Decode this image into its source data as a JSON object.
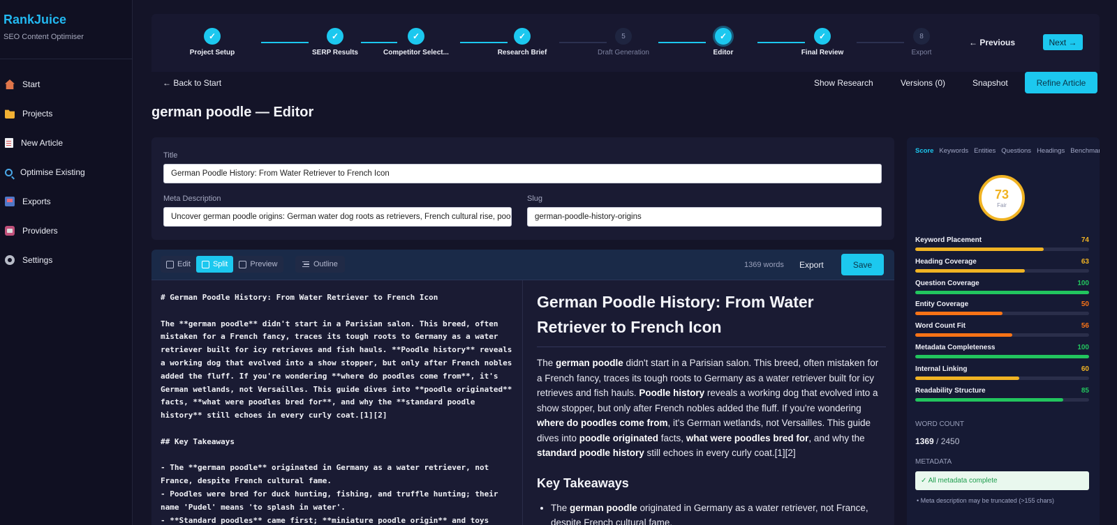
{
  "brand": {
    "name": "RankJuice",
    "subtitle": "SEO Content Optimiser"
  },
  "nav": [
    {
      "label": "Start",
      "icon": "home-icon"
    },
    {
      "label": "Projects",
      "icon": "folder-icon"
    },
    {
      "label": "New Article",
      "icon": "document-icon"
    },
    {
      "label": "Optimise Existing",
      "icon": "search-icon"
    },
    {
      "label": "Exports",
      "icon": "export-icon"
    },
    {
      "label": "Providers",
      "icon": "providers-icon"
    },
    {
      "label": "Settings",
      "icon": "gear-icon"
    }
  ],
  "stepper": {
    "steps": [
      {
        "label": "Project Setup",
        "state": "done",
        "mark": "✓"
      },
      {
        "label": "SERP Results",
        "state": "done",
        "mark": "✓"
      },
      {
        "label": "Competitor Select...",
        "state": "done",
        "mark": "✓"
      },
      {
        "label": "Research Brief",
        "state": "done",
        "mark": "✓"
      },
      {
        "label": "Draft Generation",
        "state": "pending",
        "mark": "5"
      },
      {
        "label": "Editor",
        "state": "active",
        "mark": "✓"
      },
      {
        "label": "Final Review",
        "state": "done",
        "mark": "✓"
      },
      {
        "label": "Export",
        "state": "pending",
        "mark": "8"
      }
    ],
    "previous_label": "← Previous",
    "next_label": "Next →"
  },
  "actions": {
    "back_label": "← Back to Start",
    "show_research": "Show Research",
    "versions": "Versions (0)",
    "snapshot": "Snapshot",
    "refine": "Refine Article"
  },
  "page_title": "german poodle — Editor",
  "fields": {
    "title_label": "Title",
    "title_value": "German Poodle History: From Water Retriever to French Icon",
    "meta_label": "Meta Description",
    "meta_value": "Uncover german poodle origins: German water dog roots as retrievers, French cultural rise, poodle history facts and more.",
    "slug_label": "Slug",
    "slug_value": "german-poodle-history-origins"
  },
  "editor": {
    "modes": [
      "Edit",
      "Split",
      "Preview"
    ],
    "selected_mode": "Split",
    "outline_label": "Outline",
    "word_count": "1369 words",
    "export_label": "Export",
    "save_label": "Save",
    "source": "# German Poodle History: From Water Retriever to French Icon\n\nThe **german poodle** didn't start in a Parisian salon. This breed, often mistaken for a French fancy, traces its tough roots to Germany as a water retriever built for icy retrieves and fish hauls. **Poodle history** reveals a working dog that evolved into a show stopper, but only after French nobles added the fluff. If you're wondering **where do poodles come from**, it's German wetlands, not Versailles. This guide dives into **poodle originated** facts, **what were poodles bred for**, and why the **standard poodle history** still echoes in every curly coat.[1][2]\n\n## Key Takeaways\n\n- The **german poodle** originated in Germany as a water retriever, not France, despite French cultural fame.\n- Poodles were bred for duck hunting, fishing, and truffle hunting; their name 'Pudel' means 'to splash in water'.\n- **Standard poodles** came first; **miniature poodle origin** and toys",
    "preview": {
      "h1": "German Poodle History: From Water Retriever to French Icon",
      "intro_html": "The <b>german poodle</b> didn't start in a Parisian salon. This breed, often mistaken for a French fancy, traces its tough roots to Germany as a water retriever built for icy retrieves and fish hauls. <b>Poodle history</b> reveals a working dog that evolved into a show stopper, but only after French nobles added the fluff. If you're wondering <b>where do poodles come from</b>, it's German wetlands, not Versailles. This guide dives into <b>poodle originated</b> facts, <b>what were poodles bred for</b>, and why the <b>standard poodle history</b> still echoes in every curly coat.[1][2]",
      "h2": "Key Takeaways",
      "li1_html": "The <b>german poodle</b> originated in Germany as a water retriever, not France, despite French cultural fame."
    }
  },
  "score_panel": {
    "tabs": [
      "Score",
      "Keywords",
      "Entities",
      "Questions",
      "Headings",
      "Benchmarks"
    ],
    "active_tab": "Score",
    "score": "73",
    "grade": "Fair",
    "score_color": "#f0b323",
    "metrics": [
      {
        "name": "Keyword Placement",
        "value": 74,
        "color": "#f0b323"
      },
      {
        "name": "Heading Coverage",
        "value": 63,
        "color": "#f0b323"
      },
      {
        "name": "Question Coverage",
        "value": 100,
        "color": "#22c55e"
      },
      {
        "name": "Entity Coverage",
        "value": 50,
        "color": "#f97316"
      },
      {
        "name": "Word Count Fit",
        "value": 56,
        "color": "#f97316"
      },
      {
        "name": "Metadata Completeness",
        "value": 100,
        "color": "#22c55e"
      },
      {
        "name": "Internal Linking",
        "value": 60,
        "color": "#f0b323"
      },
      {
        "name": "Readability Structure",
        "value": 85,
        "color": "#22c55e"
      }
    ],
    "word_count_label": "WORD COUNT",
    "word_count_current": "1369",
    "word_count_target": " / 2450",
    "metadata_label": "METADATA",
    "metadata_status": "✓ All metadata complete",
    "metadata_note": "• Meta description may be truncated (>155 chars)"
  },
  "colors": {
    "accent": "#1cc8ef",
    "background": "#141428",
    "sidebar": "#101022"
  }
}
